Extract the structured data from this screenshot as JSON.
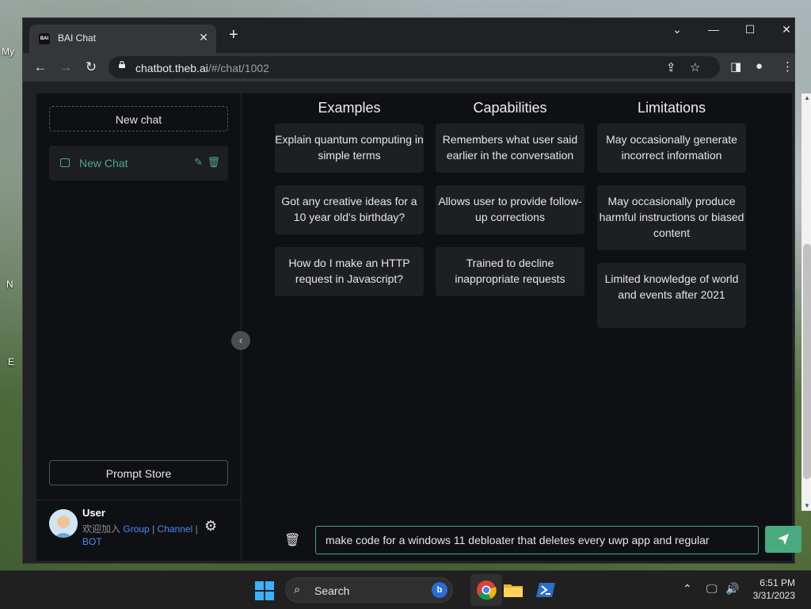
{
  "browser": {
    "tab_title": "BAI Chat",
    "tab_favicon_text": "BAI",
    "url_host": "chatbot.theb.ai",
    "url_path": "/#/chat/1002"
  },
  "desktop": {
    "label_top": "My",
    "label_mid": "N",
    "label_low": "E"
  },
  "sidebar": {
    "new_chat_label": "New chat",
    "chat_items": [
      {
        "label": "New Chat"
      }
    ],
    "prompt_store_label": "Prompt Store",
    "user": {
      "name": "User",
      "join_text": "欢迎加入",
      "group": "Group",
      "sep1": "|",
      "channel": "Channel",
      "sep2": "|",
      "bot": "BOT"
    }
  },
  "main": {
    "columns": [
      {
        "heading": "Examples",
        "cards": [
          "Explain quantum computing in simple terms",
          "Got any creative ideas for a 10 year old's birthday?",
          "How do I make an HTTP request in Javascript?"
        ]
      },
      {
        "heading": "Capabilities",
        "cards": [
          "Remembers what user said earlier in the conversation",
          "Allows user to provide follow-up corrections",
          "Trained to decline inappropriate requests"
        ]
      },
      {
        "heading": "Limitations",
        "cards": [
          "May occasionally generate incorrect information",
          "May occasionally produce harmful instructions or biased content",
          "Limited knowledge of world and events after 2021"
        ]
      }
    ],
    "input_value": "make code for a windows 11 debloater that deletes every uwp app and regular"
  },
  "taskbar": {
    "search_label": "Search",
    "time": "6:51 PM",
    "date": "3/31/2023"
  },
  "colors": {
    "accent": "#4aaa7f",
    "page_bg": "#0f1014",
    "card_bg": "#1d1f23"
  }
}
